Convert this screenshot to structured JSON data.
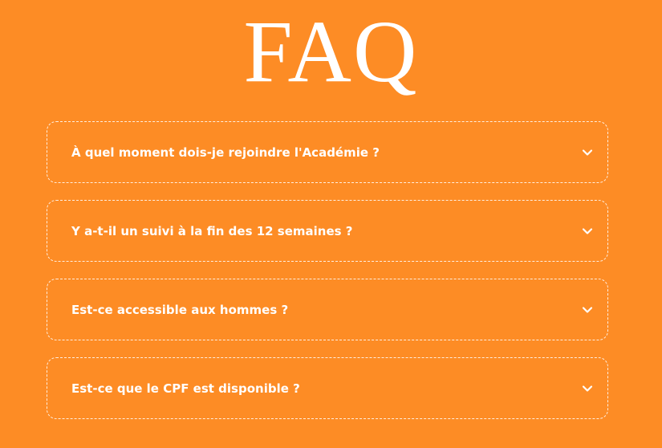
{
  "page": {
    "title": "FAQ"
  },
  "faq": {
    "items": [
      {
        "question": "À quel moment dois-je rejoindre l'Académie ?",
        "icon": "chevron-down-icon"
      },
      {
        "question": "Y a-t-il un suivi à la fin des 12 semaines ?",
        "icon": "chevron-down-icon"
      },
      {
        "question": "Est-ce accessible aux hommes ?",
        "icon": "chevron-down-icon"
      },
      {
        "question": "Est-ce que le CPF est disponible ?",
        "icon": "chevron-down-icon"
      }
    ]
  },
  "colors": {
    "background": "#fd8c25",
    "text": "#ffffff",
    "border": "#ffffff"
  }
}
